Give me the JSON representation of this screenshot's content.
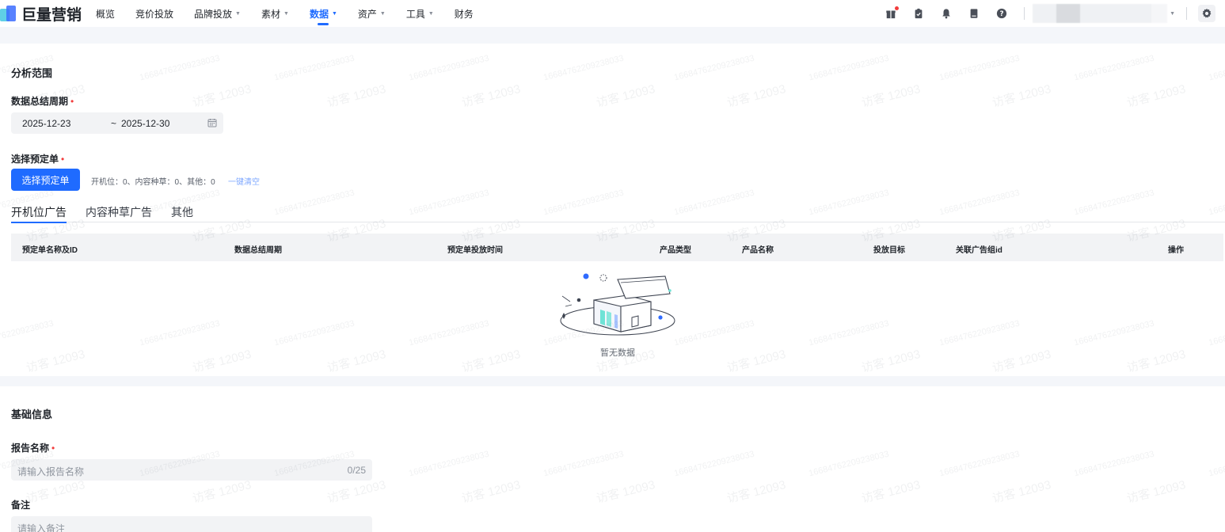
{
  "app": {
    "logo_text": "巨量营销",
    "accent": "#1f6bff"
  },
  "nav": [
    {
      "label": "概览",
      "caret": false,
      "active": false
    },
    {
      "label": "竞价投放",
      "caret": false,
      "active": false
    },
    {
      "label": "品牌投放",
      "caret": true,
      "active": false
    },
    {
      "label": "素材",
      "caret": true,
      "active": false
    },
    {
      "label": "数据",
      "caret": true,
      "active": true
    },
    {
      "label": "资产",
      "caret": true,
      "active": false
    },
    {
      "label": "工具",
      "caret": true,
      "active": false
    },
    {
      "label": "财务",
      "caret": false,
      "active": false
    }
  ],
  "topbar_icons": [
    "gift-icon",
    "clipboard-check-icon",
    "bell-icon",
    "document-icon",
    "help-icon",
    "settings-icon"
  ],
  "analysis": {
    "title": "分析范围",
    "period_label": "数据总结周期",
    "required_mark": "•",
    "start_date": "2025-12-23",
    "separator": "~",
    "end_date": "2025-12-30",
    "order_label": "选择预定单",
    "select_button": "选择预定单",
    "summary": "开机位：0、内容种草：0、其他：0",
    "clear_link": "一键清空"
  },
  "tabs": [
    {
      "label": "开机位广告",
      "active": true
    },
    {
      "label": "内容种草广告",
      "active": false
    },
    {
      "label": "其他",
      "active": false
    }
  ],
  "table": {
    "columns": [
      "预定单名称及ID",
      "数据总结周期",
      "预定单投放时间",
      "产品类型",
      "产品名称",
      "投放目标",
      "关联广告组id",
      "操作"
    ],
    "empty_text": "暂无数据"
  },
  "basic": {
    "title": "基础信息",
    "name_label": "报告名称",
    "name_placeholder": "请输入报告名称",
    "name_counter": "0/25",
    "note_label": "备注",
    "note_placeholder": "请输入备注"
  },
  "watermark": {
    "line1": "访客 12093",
    "line2": "16684762209238033"
  }
}
